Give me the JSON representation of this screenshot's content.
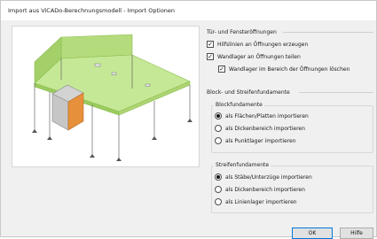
{
  "window": {
    "title": "Import aus ViCADo-Berechnungsmodell - Import Optionen"
  },
  "openings": {
    "title": "Tür- und Fensteröffnungen",
    "options": [
      {
        "label": "Hilfslinien an Öffnungen erzeugen",
        "checked": true
      },
      {
        "label": "Wandlager an Öffnungen teilen",
        "checked": true
      },
      {
        "label": "Wandlager im Bereich der Öffnungen löschen",
        "checked": true
      }
    ]
  },
  "foundations": {
    "title": "Block- und Streifenfundamente",
    "block": {
      "title": "Blockfundamente",
      "options": [
        {
          "label": "als Flächen/Platten importieren",
          "selected": true
        },
        {
          "label": "als Dickenbereich importieren",
          "selected": false
        },
        {
          "label": "als Punktlager importieren",
          "selected": false
        }
      ]
    },
    "strip": {
      "title": "Streifenfundamente",
      "options": [
        {
          "label": "als Stäbe/Unterzüge importieren",
          "selected": true
        },
        {
          "label": "als Dickenbereich importieren",
          "selected": false
        },
        {
          "label": "als Linienlager importieren",
          "selected": false
        }
      ]
    }
  },
  "buttons": {
    "ok": "OK",
    "help": "Hilfe"
  }
}
